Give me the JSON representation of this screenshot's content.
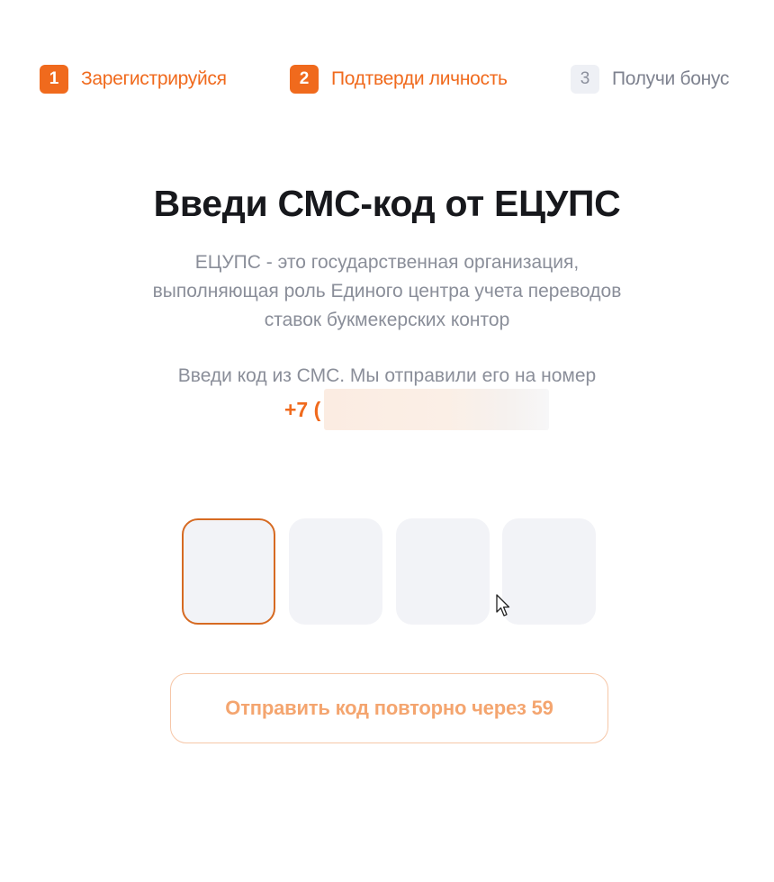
{
  "stepper": {
    "steps": [
      {
        "number": "1",
        "label": "Зарегистрируйся",
        "state": "completed"
      },
      {
        "number": "2",
        "label": "Подтверди личность",
        "state": "current"
      },
      {
        "number": "3",
        "label": "Получи бонус",
        "state": "pending"
      }
    ]
  },
  "main": {
    "title": "Введи СМС-код от ЕЦУПС",
    "description_lines": [
      "ЕЦУПС - это государственная организация,",
      "выполняющая роль Единого центра учета переводов",
      "ставок букмекерских контор"
    ],
    "sent_text": "Введи код из СМС. Мы отправили его на номер",
    "phone_prefix": "+7 ("
  },
  "code_input": {
    "digits": [
      "",
      "",
      "",
      ""
    ],
    "focused_index": 0
  },
  "resend_button": {
    "label": "Отправить код повторно через 59"
  },
  "colors": {
    "accent": "#f06a1d",
    "muted_text": "#8a8e99",
    "box_bg": "#f2f3f7"
  }
}
